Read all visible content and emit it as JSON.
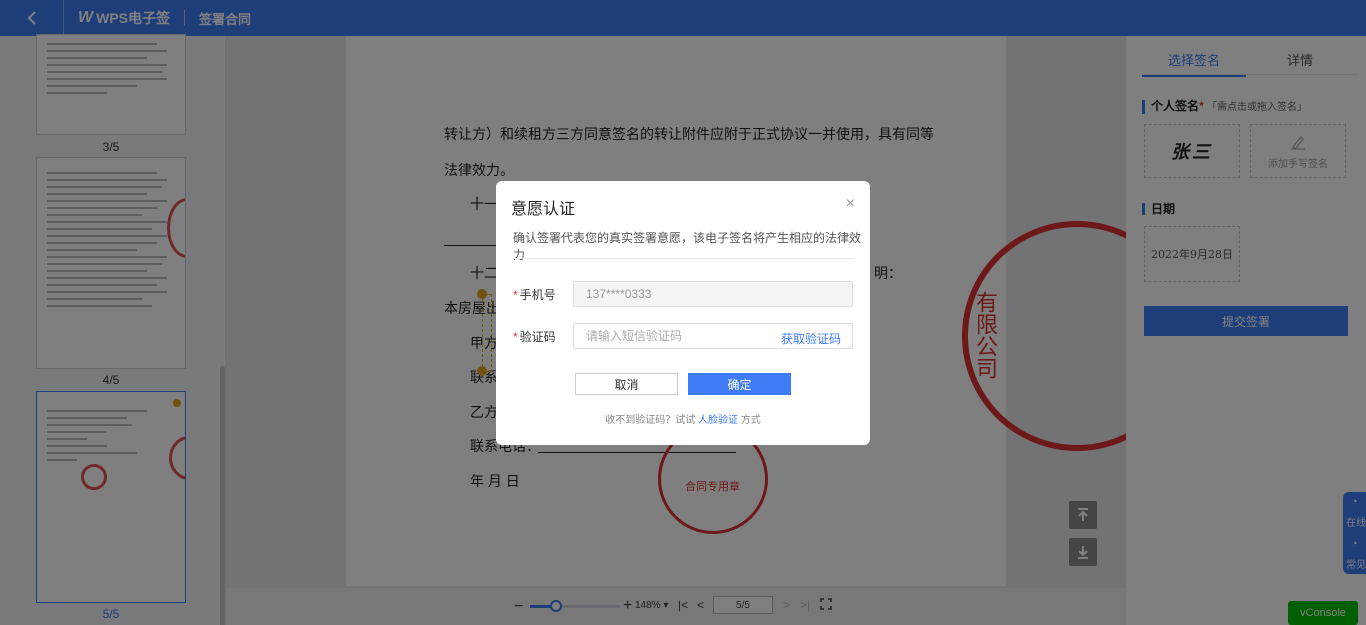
{
  "topbar": {
    "brand": "WPS电子签",
    "page_title": "签署合同"
  },
  "thumbnails": [
    {
      "label": "3/5"
    },
    {
      "label": "4/5"
    },
    {
      "label": "5/5"
    }
  ],
  "document": {
    "lines": [
      "转让方）和续租方三方同意签名的转让附件应附于正式协议一并使用，具有同等",
      "法律效力。",
      "十一",
      "十二",
      "明：",
      "本房屋出",
      "甲方",
      "联系",
      "乙方",
      "联系电话：",
      "年  月  日"
    ],
    "seal_text": "有限公司",
    "small_seal_text": "合同专用章"
  },
  "toolbar": {
    "zoom": "148%",
    "page_input": "5/5"
  },
  "right_panel": {
    "tabs": [
      "选择签名",
      "详情"
    ],
    "personal_sign": {
      "title": "个人签名",
      "required": "*",
      "hint": "「需点击或拖入签名」"
    },
    "signature_name": "张三",
    "add_handwritten": "添加手写签名",
    "date_title": "日期",
    "date_value": "2022年9月28日",
    "submit": "提交签署"
  },
  "float_help": [
    "在线",
    "常见"
  ],
  "vconsole": "vConsole",
  "modal": {
    "title": "意愿认证",
    "description": "确认签署代表您的真实签署意愿，该电子签名将产生相应的法律效力",
    "phone_label": "手机号",
    "phone_value": "137****0333",
    "code_label": "验证码",
    "code_placeholder": "请输入短信验证码",
    "get_code": "获取验证码",
    "cancel": "取消",
    "confirm": "确定",
    "footer_prefix": "收不到验证码？试试",
    "footer_link": "人脸验证",
    "footer_suffix": "方式"
  },
  "colors": {
    "accent": "#3d7cf5",
    "seal": "#dd3333",
    "vconsole": "#04be02"
  }
}
